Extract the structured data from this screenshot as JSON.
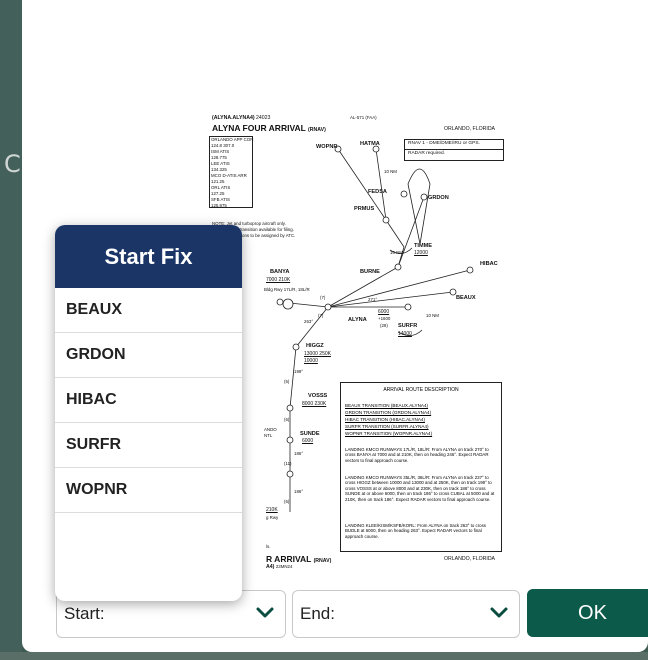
{
  "background": {
    "glyph": "C"
  },
  "chart": {
    "header_code": "(ALYNA.ALYNA4)",
    "header_amdt": "24023",
    "header_loc": "AL-571 (FAA)",
    "title": "ALYNA FOUR ARRIVAL",
    "title_suffix": "(RNAV)",
    "city": "ORLANDO, FLORIDA",
    "rnav_req": "RNAV 1 - DME/DME/IRU or GPS.",
    "radar_req": "RADAR required.",
    "freqs": [
      "ORLANDO APP CON",
      "124.8 307.0",
      "ISM ATIS",
      "128.775",
      "LEE ATIS",
      "134.325",
      "MCO D-ATIS ARR",
      "121.25",
      "ORL ATIS",
      "127.25",
      "SFB ATIS",
      "125.975"
    ],
    "note_lines": [
      "NOTE: Jet and turboprop aircraft only.",
      "NOTE: RNAV transition available for filing.",
      "Runway transitions to be assigned by ATC."
    ],
    "fixes": {
      "hatma": "HATMA",
      "wopnr": "WOPNR",
      "fedsa": "FEDSA",
      "grdon": "GRDON",
      "prmus": "PRMUS",
      "timme": "TIMME",
      "timme_alt": "12000",
      "burne": "BURNE",
      "hibac": "HIBAC",
      "beaux": "BEAUX",
      "banya": "BANYA",
      "banya_alt": "7000 210K",
      "alyna": "ALYNA",
      "surfr": "SURFR",
      "surfr_alt": "14000",
      "higgz": "HIGGZ",
      "higgz_alt": "13000 250K",
      "higgz_alt2": "10000",
      "vosss": "VOSSS",
      "vosss_alt": "8000 230K",
      "sunde": "SUNDE",
      "sunde_alt": "6000",
      "bldg_rwy": "Bldg Rwy 17L/R, 18L/R",
      "nm_10": "10 NM",
      "ndo": "ANDO",
      "ntl": "NTL",
      "k_210": "210K",
      "g_rwy": "g Rwy"
    },
    "course_labels": [
      "271°",
      "(7)",
      "263°",
      "(7)",
      "199°",
      "(5)",
      "(6)",
      "186°",
      "(11)",
      "186°",
      "(6)",
      "6000",
      "+1600",
      "(29)"
    ],
    "footer_title": "R ARRIVAL",
    "footer_suffix": "(RNAV)",
    "footer_code": "A4)",
    "footer_amdt": "23MN24",
    "footer_city": "ORLANDO, FLORIDA",
    "footer_ls": "ls.",
    "desc_title": "ARRIVAL ROUTE DESCRIPTION",
    "desc_transitions": [
      "BEAUX TRANSITION (BEAUX.ALYNA4)",
      "GRDON TRANSITION (GRDON.ALYNA4)",
      "HIBAC TRANSITION (HIBAC.ALYNA4)",
      "SURFR TRANSITION (SURFR.ALYNA4)",
      "WOPNR TRANSITION (WOPNR.ALYNA4)"
    ],
    "desc_paragraphs": [
      "LANDING KMCO RUNWAYS 17L/R, 18L/R: From ALYNA on track 270° to cross BANYA at 7000 and at 210K, then on heading 246°. Expect RADAR vectors to final approach course.",
      "LANDING KMCO RUNWAYS 35L/R, 36L/R: From ALYNA on track 237° to cross HIGGZ between 10000 and 13000 and at 250K, then on track 199° to cross VOSSS at or above 8000 and at 230K, then on track 186° to cross SUNDE at or above 6000, then on track 186° to cross CUBAL at 5000 and at 210K, then on track 186°. Expect RADAR vectors to final approach course.",
      "LANDING KLEE/KISM/KSFB/KORL: From ALYNA on track 263° to cross BUDLE at 6000, then on heading 263°. Expect RADAR vectors to final approach course."
    ]
  },
  "popover": {
    "title": "Start Fix",
    "items": [
      "BEAUX",
      "GRDON",
      "HIBAC",
      "SURFR",
      "WOPNR"
    ]
  },
  "controls": {
    "start_label": "Start:",
    "end_label": "End:",
    "ok_label": "OK"
  },
  "colors": {
    "header_navy": "#1a3566",
    "ok_green": "#0c5a4a",
    "chevron": "#0b4d40"
  }
}
